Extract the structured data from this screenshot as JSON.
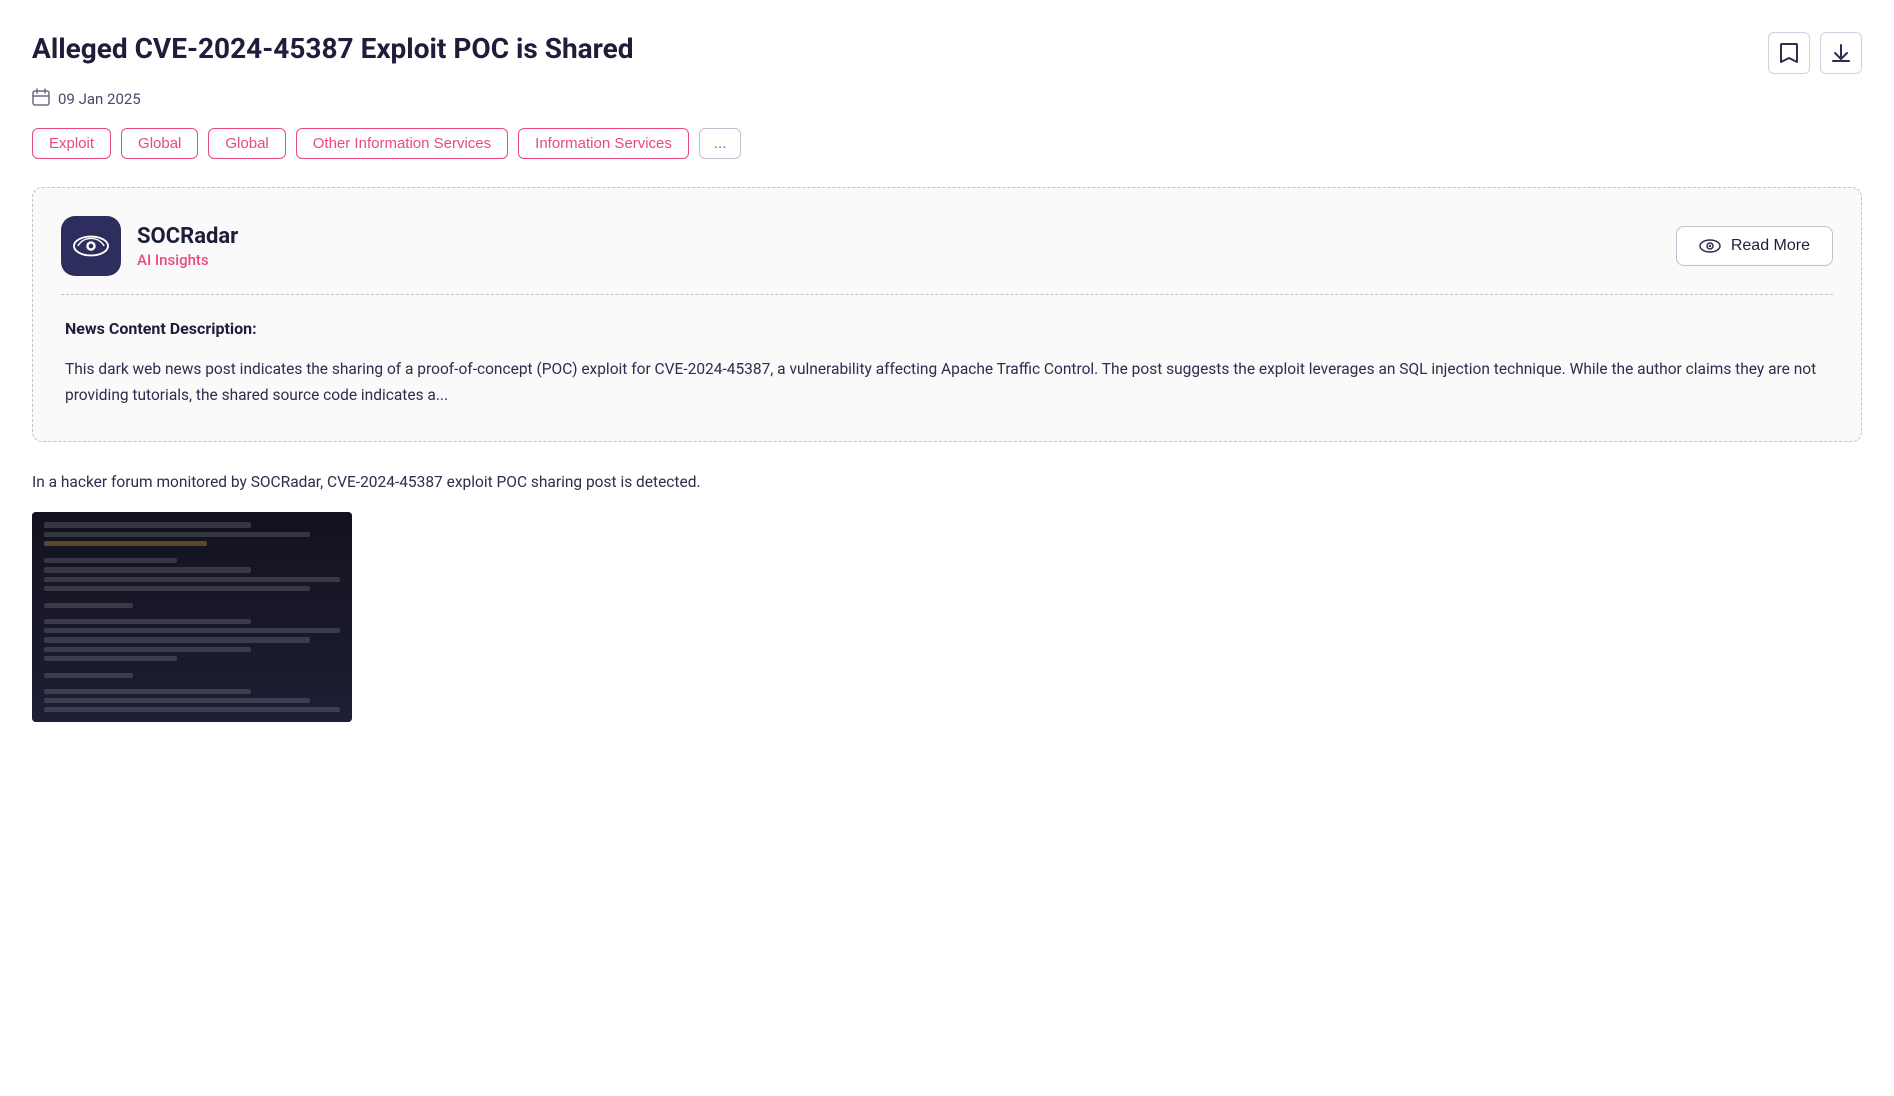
{
  "page": {
    "title": "Alleged CVE-2024-45387 Exploit POC is Shared",
    "date": "09 Jan 2025",
    "bookmark_label": "Bookmark",
    "download_label": "Download"
  },
  "tags": [
    {
      "id": "exploit",
      "label": "Exploit"
    },
    {
      "id": "global1",
      "label": "Global"
    },
    {
      "id": "global2",
      "label": "Global"
    },
    {
      "id": "other-info",
      "label": "Other Information Services"
    },
    {
      "id": "info-services",
      "label": "Information Services"
    },
    {
      "id": "more",
      "label": "..."
    }
  ],
  "insight_card": {
    "brand_name": "SOCRadar",
    "brand_sub": "AI Insights",
    "read_more_label": "Read More",
    "section_label": "News Content Description:",
    "description": "This dark web news post indicates the sharing of a proof-of-concept (POC) exploit for CVE-2024-45387, a vulnerability affecting Apache Traffic Control. The post suggests the exploit leverages an SQL injection technique. While the author claims they are not providing tutorials, the shared source code indicates a..."
  },
  "body": {
    "intro_text": "In a hacker forum monitored by SOCRadar, CVE-2024-45387 exploit POC sharing post is detected."
  },
  "icons": {
    "calendar": "📅",
    "bookmark": "🔖",
    "download": "⬇",
    "eye": "👁"
  }
}
